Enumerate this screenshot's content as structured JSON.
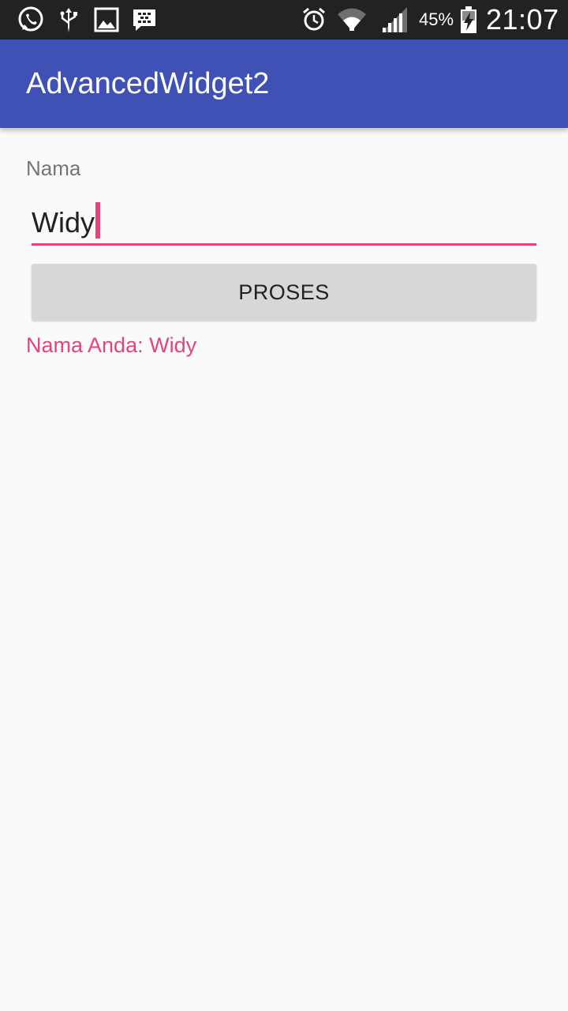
{
  "status_bar": {
    "icons": [
      "whatsapp-icon",
      "usb-icon",
      "gallery-icon",
      "bbm-icon",
      "alarm-icon",
      "wifi-icon",
      "signal-icon",
      "battery-charging-icon"
    ],
    "battery_percent": "45%",
    "time": "21:07"
  },
  "app_bar": {
    "title": "AdvancedWidget2",
    "color": "#3f51b5"
  },
  "form": {
    "name_label": "Nama",
    "name_value": "Widy",
    "button_label": "PROSES",
    "result_text": "Nama Anda: Widy",
    "accent_color": "#e0457b"
  }
}
